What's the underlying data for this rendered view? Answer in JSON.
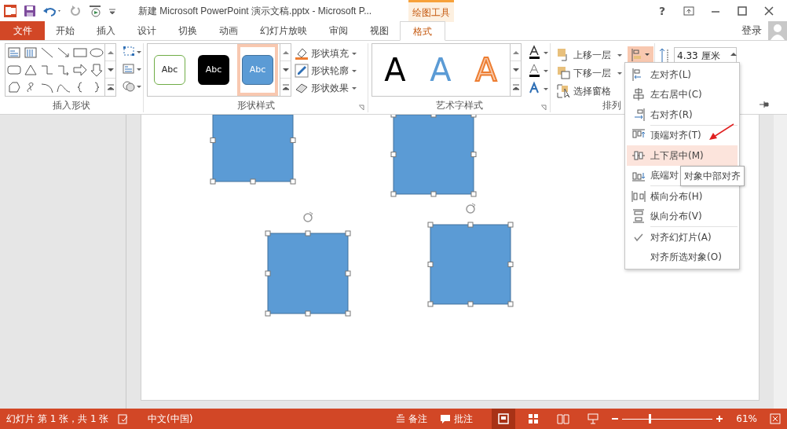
{
  "title_bar": {
    "title": "新建 Microsoft PowerPoint 演示文稿.pptx - Microsoft P...",
    "contextual_label": "绘图工具",
    "help": "?",
    "sign_in": "登录"
  },
  "tabs": [
    {
      "label": "文件",
      "kind": "file",
      "selected": false
    },
    {
      "label": "开始",
      "kind": "normal",
      "selected": false
    },
    {
      "label": "插入",
      "kind": "normal",
      "selected": false
    },
    {
      "label": "设计",
      "kind": "normal",
      "selected": false
    },
    {
      "label": "切换",
      "kind": "normal",
      "selected": false
    },
    {
      "label": "动画",
      "kind": "normal",
      "selected": false
    },
    {
      "label": "幻灯片放映",
      "kind": "normal",
      "selected": false
    },
    {
      "label": "审阅",
      "kind": "normal",
      "selected": false
    },
    {
      "label": "视图",
      "kind": "normal",
      "selected": false
    },
    {
      "label": "格式",
      "kind": "contextual",
      "selected": true
    }
  ],
  "ribbon": {
    "insert_shapes": {
      "label": "插入形状"
    },
    "shape_styles": {
      "label": "形状样式",
      "styles": [
        {
          "text": "Abc",
          "kind": "outline",
          "selected": false
        },
        {
          "text": "Abc",
          "kind": "dark",
          "selected": false
        },
        {
          "text": "Abc",
          "kind": "blue",
          "selected": true
        }
      ],
      "commands": [
        "形状填充",
        "形状轮廓",
        "形状效果"
      ]
    },
    "wordart_styles": {
      "label": "艺术字样式",
      "styles": [
        {
          "text": "A",
          "kind": "black"
        },
        {
          "text": "A",
          "kind": "blue"
        },
        {
          "text": "A",
          "kind": "orange"
        }
      ]
    },
    "arrange": {
      "label": "排列",
      "commands": [
        "上移一层",
        "下移一层",
        "选择窗格"
      ]
    },
    "size": {
      "height": "4.33 厘米"
    }
  },
  "align_menu": {
    "items": [
      {
        "kind": "item",
        "label": "左对齐(L)",
        "selected": false,
        "checked": false
      },
      {
        "kind": "item",
        "label": "左右居中(C)",
        "selected": false,
        "checked": false
      },
      {
        "kind": "item",
        "label": "右对齐(R)",
        "selected": false,
        "checked": false
      },
      {
        "kind": "separator"
      },
      {
        "kind": "item",
        "label": "顶端对齐(T)",
        "selected": false,
        "checked": false
      },
      {
        "kind": "item",
        "label": "上下居中(M)",
        "selected": true,
        "checked": false
      },
      {
        "kind": "item",
        "label": "底端对",
        "selected": false,
        "checked": false
      },
      {
        "kind": "separator"
      },
      {
        "kind": "item",
        "label": "横向分布(H)",
        "selected": false,
        "checked": false
      },
      {
        "kind": "item",
        "label": "纵向分布(V)",
        "selected": false,
        "checked": false
      },
      {
        "kind": "separator"
      },
      {
        "kind": "item",
        "label": "对齐幻灯片(A)",
        "selected": false,
        "checked": true
      },
      {
        "kind": "item",
        "label": "对齐所选对象(O)",
        "selected": false,
        "checked": false
      }
    ],
    "tooltip": "对象中部对齐"
  },
  "status_bar": {
    "slide_info": "幻灯片 第 1 张，共 1 张",
    "language": "中文(中国)",
    "notes": "备注",
    "comments": "批注",
    "views": [
      {
        "kind": "normal",
        "selected": true
      },
      {
        "kind": "sorter",
        "selected": false
      },
      {
        "kind": "reading",
        "selected": false
      },
      {
        "kind": "slideshow",
        "selected": false
      }
    ],
    "zoom": {
      "level": 0.3,
      "reading": "61%"
    }
  }
}
